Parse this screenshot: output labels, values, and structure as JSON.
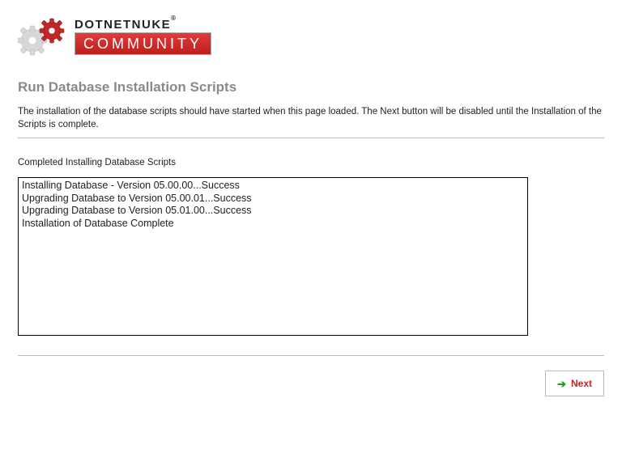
{
  "brand": {
    "name": "DOTNETNUKE",
    "registered": "®",
    "community": "COMMUNITY"
  },
  "page": {
    "title": "Run Database Installation Scripts",
    "intro": "The installation of the database scripts should have started when this page loaded. The Next button will be disabled until the Installation of the Scripts is complete."
  },
  "status": {
    "label": "Completed Installing Database Scripts",
    "lines": [
      "Installing Database - Version 05.00.00...Success",
      "Upgrading Database to Version 05.00.01...Success",
      "Upgrading Database to Version 05.01.00...Success",
      "Installation of Database Complete"
    ]
  },
  "buttons": {
    "next": "Next"
  }
}
